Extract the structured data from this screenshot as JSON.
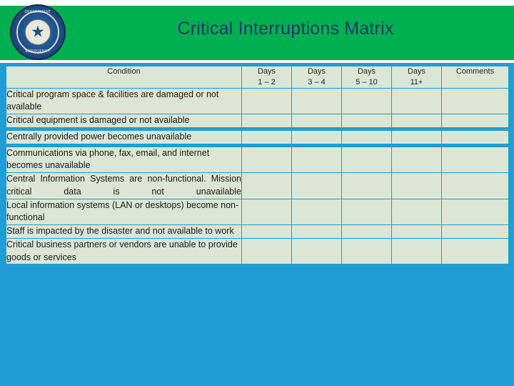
{
  "slide": {
    "title": "Critical Interruptions Matrix",
    "seal": {
      "name": "department-seal",
      "top_text": "DEPARTMENT",
      "bottom_text": "EMERGENCY"
    },
    "colors": {
      "banner_green": "#00B050",
      "title_blue": "#1F3864",
      "body_blue": "#1F9DD4",
      "cell_bg": "#DCE6D5"
    }
  },
  "table": {
    "headers": [
      {
        "line1": "Condition",
        "line2": ""
      },
      {
        "line1": "Days",
        "line2": "1 – 2"
      },
      {
        "line1": "Days",
        "line2": "3 – 4"
      },
      {
        "line1": "Days",
        "line2": "5 – 10"
      },
      {
        "line1": "Days",
        "line2": "11+"
      },
      {
        "line1": "Comments",
        "line2": ""
      }
    ],
    "rows": [
      {
        "condition": "Critical program space & facilities are damaged or not available",
        "justified": false
      },
      {
        "condition": "Critical equipment is damaged or not available",
        "justified": false
      },
      {
        "condition": "Centrally provided power becomes unavailable",
        "justified": false
      },
      {
        "condition": "Communications via phone, fax, email, and internet becomes unavailable",
        "justified": false
      },
      {
        "condition": "Central Information Systems are non-functional.  Mission critical data is not unavailable",
        "justified": true
      },
      {
        "condition": "Local information systems (LAN or desktops) become non-functional",
        "justified": false
      },
      {
        "condition": "Staff is impacted by the disaster and not available to work",
        "justified": false
      },
      {
        "condition": "Critical business partners or vendors are unable to provide goods or services",
        "justified": false
      }
    ]
  }
}
